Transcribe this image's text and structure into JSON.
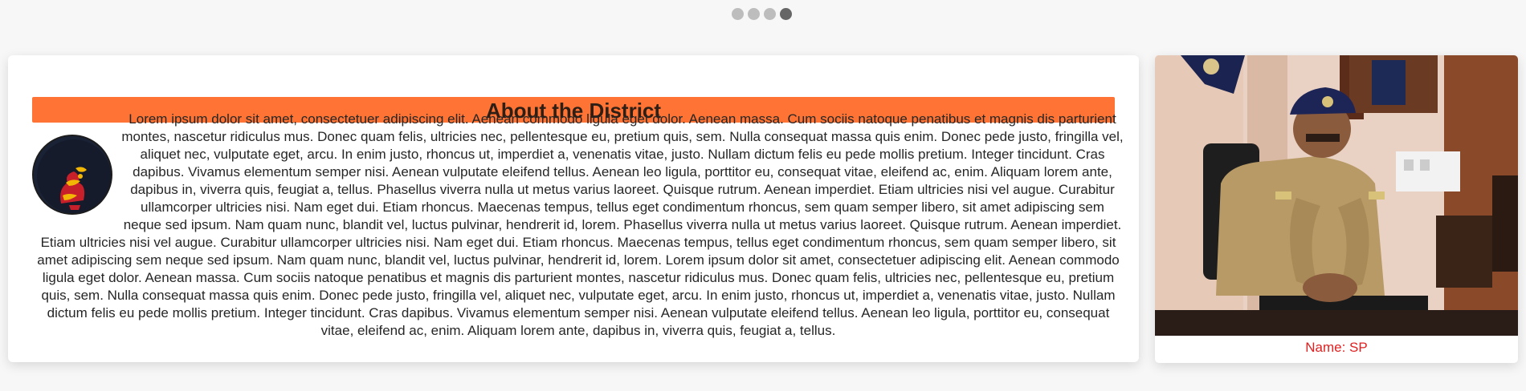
{
  "carousel": {
    "dot_count": 4,
    "active_index": 3,
    "dot_color": "#bdbdbd",
    "active_dot_color": "#666666"
  },
  "about": {
    "title": "About the District",
    "title_bg_color": "#ff7434",
    "emblem_icon": "district-emblem-icon",
    "body": "Lorem ipsum dolor sit amet, consectetuer adipiscing elit. Aenean commodo ligula eget dolor. Aenean massa. Cum sociis natoque penatibus et magnis dis parturient montes, nascetur ridiculus mus. Donec quam felis, ultricies nec, pellentesque eu, pretium quis, sem. Nulla consequat massa quis enim. Donec pede justo, fringilla vel, aliquet nec, vulputate eget, arcu. In enim justo, rhoncus ut, imperdiet a, venenatis vitae, justo. Nullam dictum felis eu pede mollis pretium. Integer tincidunt. Cras dapibus. Vivamus elementum semper nisi. Aenean vulputate eleifend tellus. Aenean leo ligula, porttitor eu, consequat vitae, eleifend ac, enim. Aliquam lorem ante, dapibus in, viverra quis, feugiat a, tellus. Phasellus viverra nulla ut metus varius laoreet. Quisque rutrum. Aenean imperdiet. Etiam ultricies nisi vel augue. Curabitur ullamcorper ultricies nisi. Nam eget dui. Etiam rhoncus. Maecenas tempus, tellus eget condimentum rhoncus, sem quam semper libero, sit amet adipiscing sem neque sed ipsum. Nam quam nunc, blandit vel, luctus pulvinar, hendrerit id, lorem. Phasellus viverra nulla ut metus varius laoreet. Quisque rutrum. Aenean imperdiet. Etiam ultricies nisi vel augue. Curabitur ullamcorper ultricies nisi. Nam eget dui. Etiam rhoncus. Maecenas tempus, tellus eget condimentum rhoncus, sem quam semper libero, sit amet adipiscing sem neque sed ipsum. Nam quam nunc, blandit vel, luctus pulvinar, hendrerit id, lorem. Lorem ipsum dolor sit amet, consectetuer adipiscing elit. Aenean commodo ligula eget dolor. Aenean massa. Cum sociis natoque penatibus et magnis dis parturient montes, nascetur ridiculus mus. Donec quam felis, ultricies nec, pellentesque eu, pretium quis, sem. Nulla consequat massa quis enim. Donec pede justo, fringilla vel, aliquet nec, vulputate eget, arcu. In enim justo, rhoncus ut, imperdiet a, venenatis vitae, justo. Nullam dictum felis eu pede mollis pretium. Integer tincidunt. Cras dapibus. Vivamus elementum semper nisi. Aenean vulputate eleifend tellus. Aenean leo ligula, porttitor eu, consequat vitae, eleifend ac, enim. Aliquam lorem ante, dapibus in, viverra quis, feugiat a, tellus."
  },
  "officer": {
    "caption": "Name: SP",
    "caption_color": "#e02020",
    "photo_icon": "officer-photo"
  }
}
